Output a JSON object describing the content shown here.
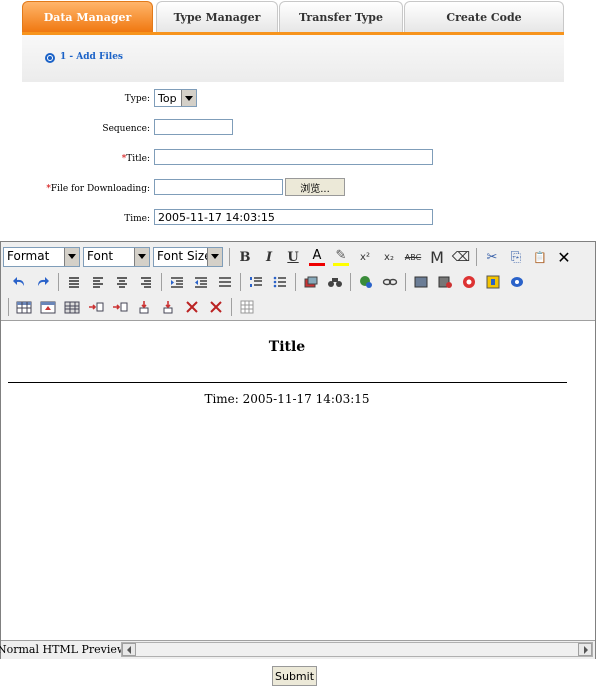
{
  "tabs": [
    "Data Manager",
    "Type Manager",
    "Transfer Type",
    "Create Code"
  ],
  "step": {
    "label": "1 - Add Files"
  },
  "form": {
    "type_label": "Type:",
    "type_value": "Top",
    "sequence_label": "Sequence:",
    "sequence_value": "",
    "title_req": "*",
    "title_label": "Title:",
    "title_value": "",
    "file_req": "*",
    "file_label": "File for Downloading:",
    "file_value": "",
    "browse_label": "浏览...",
    "time_label": "Time:",
    "time_value": "2005-11-17 14:03:15"
  },
  "editor": {
    "format": "Format",
    "font": "Font",
    "size": "Font Size",
    "row1": [
      "B",
      "I",
      "U",
      "A",
      "✎",
      "x²",
      "x₂",
      "ABC",
      "M",
      "⌫",
      "✂",
      "⎘",
      "📋",
      "✕"
    ],
    "row1_icons": [
      "bold-icon",
      "italic-icon",
      "underline-icon",
      "font-color-icon",
      "highlight-icon",
      "superscript-icon",
      "subscript-icon",
      "strikethrough-icon",
      "m-icon",
      "eraser-icon",
      "cut-icon",
      "copy-icon",
      "paste-icon",
      "close-icon"
    ],
    "doc_title": "Title",
    "doc_time": "Time: 2005-11-17 14:03:15",
    "mode": "Normal HTML Preview"
  },
  "submit_label": "Submit"
}
